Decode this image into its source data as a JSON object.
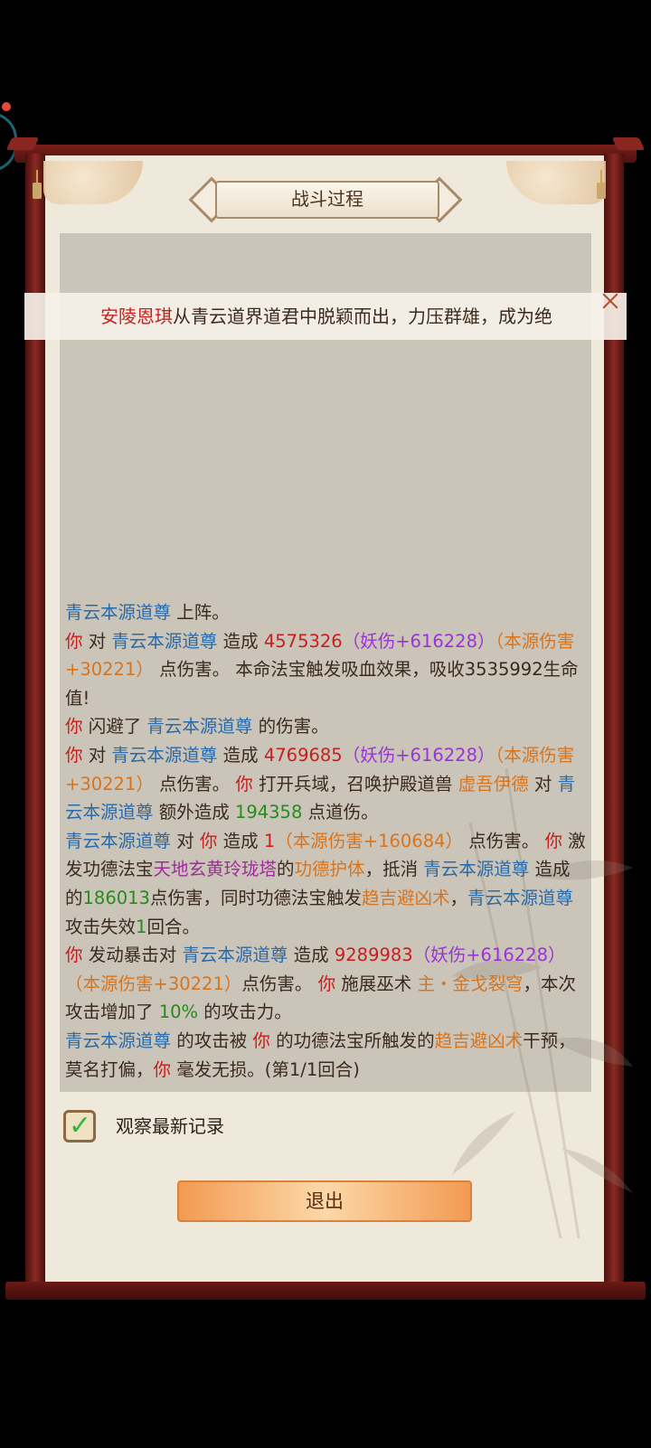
{
  "window": {
    "title": "战斗过程"
  },
  "banner": {
    "name": "安陵恩琪",
    "text": "从青云道界道君中脱颖而出，力压群雄，成为绝"
  },
  "log": [
    [
      {
        "t": "青云本源道尊",
        "c": "u"
      },
      {
        "t": " 上阵。",
        "c": ""
      }
    ],
    [
      {
        "t": "你",
        "c": "r"
      },
      {
        "t": " 对 ",
        "c": ""
      },
      {
        "t": "青云本源道尊",
        "c": "u"
      },
      {
        "t": " 造成 ",
        "c": ""
      },
      {
        "t": "4575326",
        "c": "r"
      },
      {
        "t": "（妖伤+616228）",
        "c": "p"
      },
      {
        "t": "（本源伤害+30221）",
        "c": "o"
      },
      {
        "t": " 点伤害。 本命法宝触发吸血效果，吸收3535992生命值!",
        "c": ""
      }
    ],
    [
      {
        "t": "你",
        "c": "r"
      },
      {
        "t": " 闪避了 ",
        "c": ""
      },
      {
        "t": "青云本源道尊",
        "c": "u"
      },
      {
        "t": " 的伤害。",
        "c": ""
      }
    ],
    [
      {
        "t": "你",
        "c": "r"
      },
      {
        "t": " 对 ",
        "c": ""
      },
      {
        "t": "青云本源道尊",
        "c": "u"
      },
      {
        "t": " 造成 ",
        "c": ""
      },
      {
        "t": "4769685",
        "c": "r"
      },
      {
        "t": "（妖伤+616228）",
        "c": "p"
      },
      {
        "t": "（本源伤害+30221）",
        "c": "o"
      },
      {
        "t": " 点伤害。 ",
        "c": ""
      },
      {
        "t": "你",
        "c": "r"
      },
      {
        "t": " 打开兵域，召唤护殿道兽 ",
        "c": ""
      },
      {
        "t": "虚吾伊德",
        "c": "o"
      },
      {
        "t": " 对 ",
        "c": ""
      },
      {
        "t": "青云本源道尊",
        "c": "u"
      },
      {
        "t": " 额外造成 ",
        "c": ""
      },
      {
        "t": "194358",
        "c": "g"
      },
      {
        "t": " 点道伤。",
        "c": ""
      }
    ],
    [
      {
        "t": "青云本源道尊",
        "c": "u"
      },
      {
        "t": " 对 ",
        "c": ""
      },
      {
        "t": "你",
        "c": "r"
      },
      {
        "t": " 造成 ",
        "c": ""
      },
      {
        "t": "1",
        "c": "r"
      },
      {
        "t": "（本源伤害+160684）",
        "c": "o"
      },
      {
        "t": " 点伤害。 ",
        "c": ""
      },
      {
        "t": "你",
        "c": "r"
      },
      {
        "t": " 激发功德法宝",
        "c": ""
      },
      {
        "t": "天地玄黄玲珑塔",
        "c": "m"
      },
      {
        "t": "的",
        "c": ""
      },
      {
        "t": "功德护体",
        "c": "o"
      },
      {
        "t": "，抵消 ",
        "c": ""
      },
      {
        "t": "青云本源道尊",
        "c": "u"
      },
      {
        "t": " 造成的",
        "c": ""
      },
      {
        "t": "186013",
        "c": "g"
      },
      {
        "t": "点伤害，同时功德法宝触发",
        "c": ""
      },
      {
        "t": "趋吉避凶术",
        "c": "o"
      },
      {
        "t": "，",
        "c": ""
      },
      {
        "t": "青云本源道尊",
        "c": "u"
      },
      {
        "t": "攻击失效",
        "c": ""
      },
      {
        "t": "1",
        "c": "g"
      },
      {
        "t": "回合。",
        "c": ""
      }
    ],
    [
      {
        "t": "你",
        "c": "r"
      },
      {
        "t": " 发动暴击对 ",
        "c": ""
      },
      {
        "t": "青云本源道尊",
        "c": "u"
      },
      {
        "t": " 造成 ",
        "c": ""
      },
      {
        "t": "9289983",
        "c": "r"
      },
      {
        "t": "（妖伤+616228）",
        "c": "p"
      },
      {
        "t": "（本源伤害+30221）",
        "c": "o"
      },
      {
        "t": "点伤害。 ",
        "c": ""
      },
      {
        "t": "你",
        "c": "r"
      },
      {
        "t": " 施展巫术 ",
        "c": ""
      },
      {
        "t": "主・金戈裂穹",
        "c": "o"
      },
      {
        "t": "，本次攻击增加了 ",
        "c": ""
      },
      {
        "t": "10%",
        "c": "g"
      },
      {
        "t": " 的攻击力。",
        "c": ""
      }
    ],
    [
      {
        "t": "青云本源道尊",
        "c": "u"
      },
      {
        "t": " 的攻击被 ",
        "c": ""
      },
      {
        "t": "你",
        "c": "r"
      },
      {
        "t": " 的功德法宝所触发的",
        "c": ""
      },
      {
        "t": "趋吉避凶术",
        "c": "o"
      },
      {
        "t": "干预，莫名打偏，",
        "c": ""
      },
      {
        "t": "你",
        "c": "r"
      },
      {
        "t": " 毫发无损。(第1/1回合)",
        "c": ""
      }
    ]
  ],
  "options": {
    "watch_latest_label": "观察最新记录",
    "watch_latest_checked": true
  },
  "buttons": {
    "exit_label": "退出"
  }
}
